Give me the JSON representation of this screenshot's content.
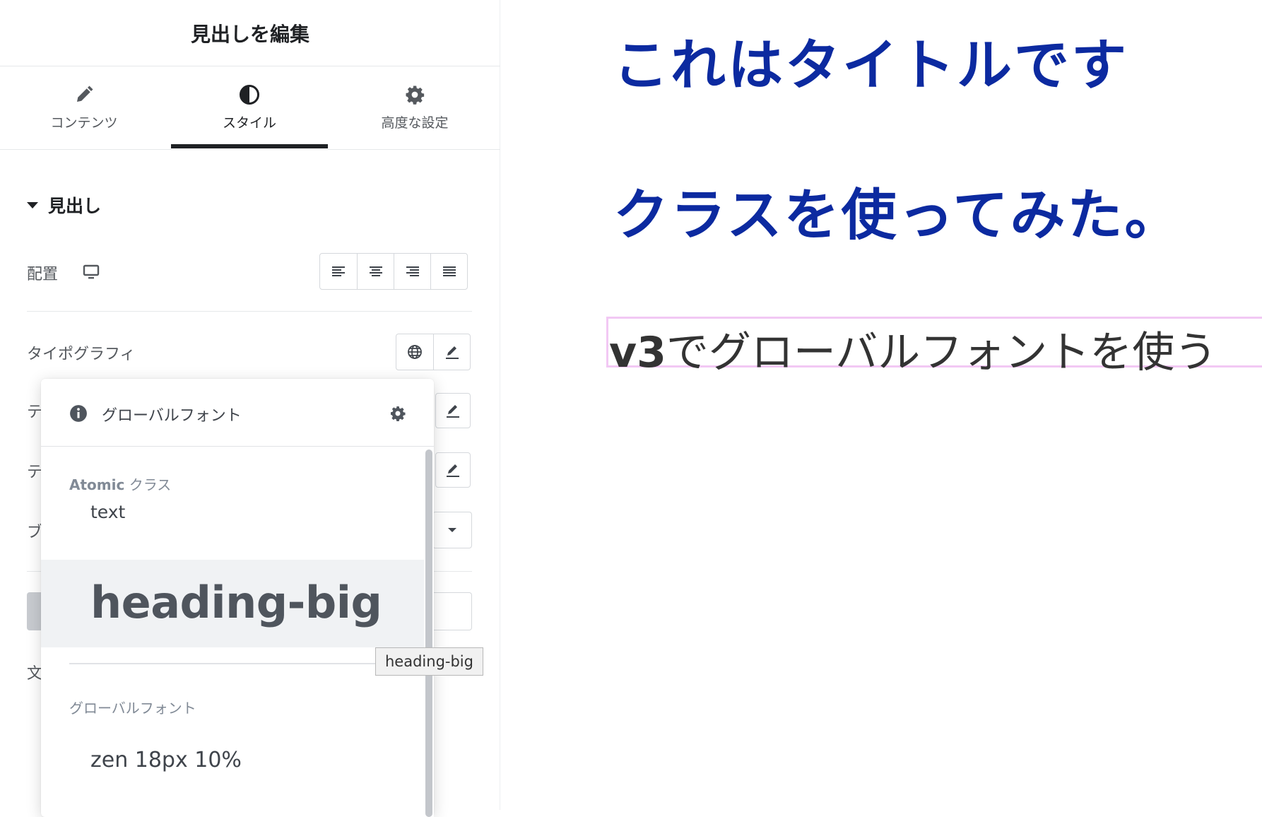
{
  "panel": {
    "title": "見出しを編集",
    "tabs": [
      {
        "label": "コンテンツ",
        "icon": "pencil-icon"
      },
      {
        "label": "スタイル",
        "icon": "half-circle-icon"
      },
      {
        "label": "高度な設定",
        "icon": "gear-icon"
      }
    ],
    "active_tab": "スタイル",
    "section": {
      "title": "見出し"
    },
    "alignment": {
      "label": "配置",
      "device_icon": "desktop-icon",
      "options": [
        "align-left-icon",
        "align-center-icon",
        "align-right-icon",
        "align-justify-icon"
      ]
    },
    "typography": {
      "label": "タイポグラフィ"
    },
    "truncated_labels": [
      "テ",
      "テ",
      "ブ",
      "文"
    ]
  },
  "dropdown": {
    "header_label": "グローバルフォント",
    "atomic_group": {
      "prefix": "Atomic",
      "suffix": " クラス"
    },
    "atomic_items": [
      {
        "label": "text"
      },
      {
        "label": "heading-big"
      }
    ],
    "global_group_title": "グローバルフォント",
    "global_items": [
      {
        "label": "zen 18px 10%"
      }
    ]
  },
  "tooltip": {
    "text": "heading-big"
  },
  "preview": {
    "heading_1": "これはタイトルです",
    "heading_2": "クラスを使ってみた。",
    "selected_heading_prefix": "v3",
    "selected_heading_rest": "でグローバルフォントを使う"
  },
  "colors": {
    "heading_blue": "#0c2aa0",
    "selection_border": "#f2c8f4",
    "active_tab_underline": "#1f2124"
  }
}
